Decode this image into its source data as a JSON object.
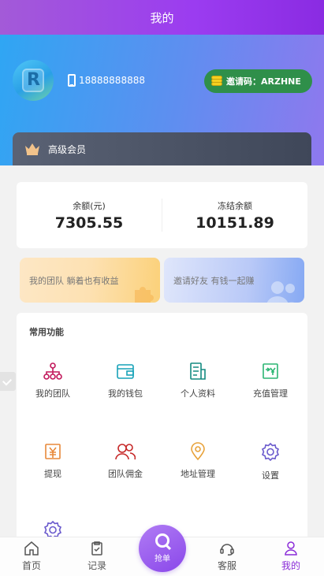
{
  "header": {
    "title": "我的"
  },
  "profile": {
    "phone": "18888888888",
    "invite_text": "邀请码：ARZHNE"
  },
  "vip": {
    "label": "高级会员"
  },
  "balance": [
    {
      "label": "余额(元)",
      "value": "7305.55"
    },
    {
      "label": "冻结余额",
      "value": "10151.89"
    }
  ],
  "promos": [
    {
      "label": "我的团队 躺着也有收益"
    },
    {
      "label": "邀请好友 有钱一起赚"
    }
  ],
  "functions": {
    "title": "常用功能",
    "items": [
      {
        "label": "我的团队",
        "icon": "team-icon",
        "color": "#c2185b"
      },
      {
        "label": "我的钱包",
        "icon": "wallet-icon",
        "color": "#17a2b8"
      },
      {
        "label": "个人资料",
        "icon": "profile-doc-icon",
        "color": "#138a80"
      },
      {
        "label": "充值管理",
        "icon": "recharge-icon",
        "color": "#2bb673"
      },
      {
        "label": "提现",
        "icon": "withdraw-icon",
        "color": "#e8893a"
      },
      {
        "label": "团队佣金",
        "icon": "commission-icon",
        "color": "#c62828"
      },
      {
        "label": "地址管理",
        "icon": "location-icon",
        "color": "#e8a23a"
      },
      {
        "label": "设置",
        "icon": "gear-icon",
        "color": "#6a5acd"
      }
    ]
  },
  "tabbar": {
    "items": [
      {
        "label": "首页",
        "icon": "home-icon"
      },
      {
        "label": "记录",
        "icon": "record-icon"
      },
      {
        "label": "客服",
        "icon": "support-icon"
      },
      {
        "label": "我的",
        "icon": "user-icon",
        "active": true
      }
    ],
    "center": {
      "label": "抢单",
      "icon": "search-icon"
    }
  },
  "colors": {
    "accent": "#8a2be2",
    "invite_bg": "#2f8f4a",
    "vip_bg": "#4a5266"
  }
}
